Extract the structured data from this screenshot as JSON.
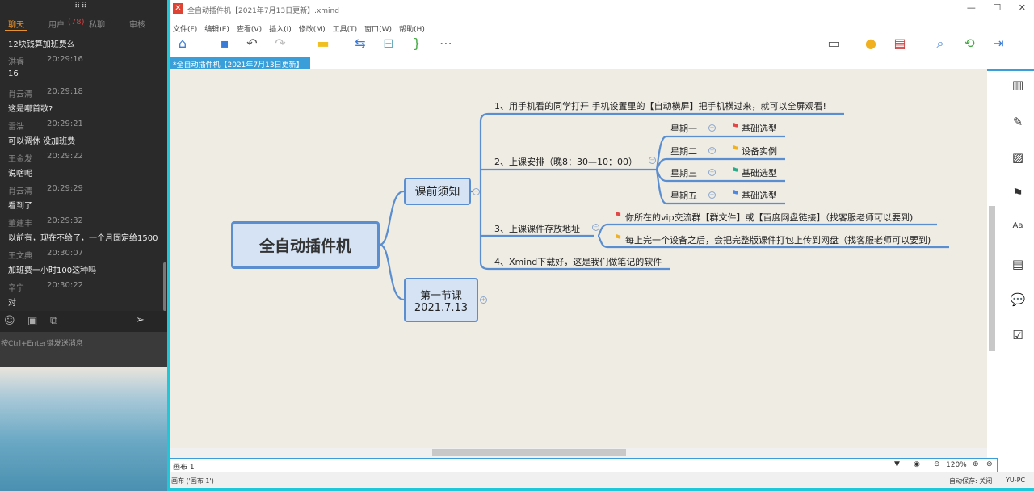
{
  "chat": {
    "tabs": [
      "聊天",
      "用户",
      "(78)",
      "私聊",
      "审核"
    ],
    "first_text": "12块钱算加班费么",
    "messages": [
      {
        "name": "洪睿",
        "time": "20:29:16",
        "text": "16"
      },
      {
        "name": "肖云清",
        "time": "20:29:18",
        "text": "这是哪首歌?"
      },
      {
        "name": "雷浩",
        "time": "20:29:21",
        "text": "可以调休 没加班费"
      },
      {
        "name": "王金发",
        "time": "20:29:22",
        "text": "说啥呢"
      },
      {
        "name": "肖云清",
        "time": "20:29:29",
        "text": "看到了"
      },
      {
        "name": "董建丰",
        "time": "20:29:32",
        "text": "以前有，现在不给了，一个月固定给1500"
      },
      {
        "name": "王文典",
        "time": "20:30:07",
        "text": "加班费一小时100这种吗"
      },
      {
        "name": "辛宁",
        "time": "20:30:22",
        "text": "对"
      }
    ],
    "input_placeholder": "按Ctrl+Enter键发送消息"
  },
  "window": {
    "title": "全自动插件机【2021年7月13日更新】.xmind",
    "menu": [
      "文件(F)",
      "编辑(E)",
      "查看(V)",
      "插入(I)",
      "修改(M)",
      "工具(T)",
      "窗口(W)",
      "帮助(H)"
    ],
    "tab": "*全自动插件机【2021年7月13日更新】"
  },
  "mindmap": {
    "central": "全自动插件机",
    "main1": "课前须知",
    "main2_line1": "第一节课",
    "main2_line2": "2021.7.13",
    "items": [
      "1、用手机看的同学打开 手机设置里的【自动横屏】把手机横过来，就可以全屏观看!",
      "2、上课安排（晚8：30—10：00）",
      "3、上课课件存放地址",
      "4、Xmind下载好，这是我们做笔记的软件"
    ],
    "days": [
      {
        "day": "星期一",
        "label": "基础选型",
        "flag": "#e04848"
      },
      {
        "day": "星期二",
        "label": "设备实例",
        "flag": "#f0b020"
      },
      {
        "day": "星期三",
        "label": "基础选型",
        "flag": "#2aa888"
      },
      {
        "day": "星期五",
        "label": "基础选型",
        "flag": "#4a88e8"
      }
    ],
    "storage": [
      {
        "text": "你所在的vip交流群【群文件】或【百度网盘链接】（找客服老师可以要到)",
        "flag": "#e04848"
      },
      {
        "text": "每上完一个设备之后，会把完整版课件打包上传到网盘（找客服老师可以要到)",
        "flag": "#f0b020"
      }
    ]
  },
  "sheetbar": {
    "sheet": "画布 1",
    "zoom": "120%"
  },
  "status": {
    "left": "画布 ('画布 1')",
    "autosave": "自动保存: 关闭",
    "user": "YU-PC"
  }
}
